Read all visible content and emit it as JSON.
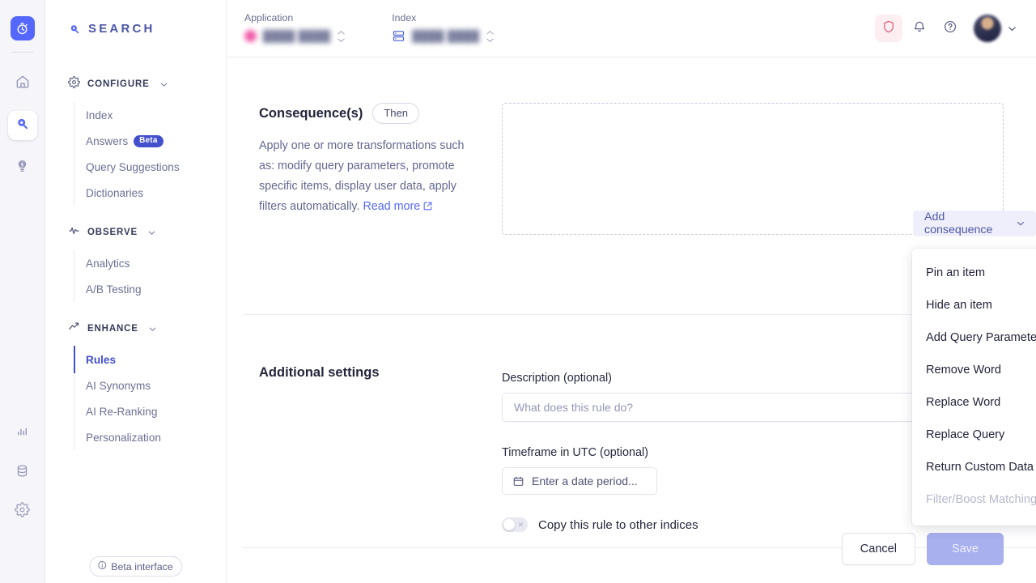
{
  "rail": {
    "logo": "algolia-logo",
    "items": [
      {
        "name": "home-icon"
      },
      {
        "name": "search-icon",
        "active": true
      },
      {
        "name": "recommend-bulb-icon"
      }
    ],
    "bottom_items": [
      {
        "name": "analytics-bars-icon"
      },
      {
        "name": "database-icon"
      },
      {
        "name": "gear-icon"
      }
    ]
  },
  "sidebar": {
    "brand": "SEARCH",
    "beta_chip": "Beta interface",
    "groups": [
      {
        "title": "CONFIGURE",
        "icon": "gear-icon",
        "items": [
          {
            "label": "Index"
          },
          {
            "label": "Answers",
            "badge": "Beta"
          },
          {
            "label": "Query Suggestions"
          },
          {
            "label": "Dictionaries"
          }
        ]
      },
      {
        "title": "OBSERVE",
        "icon": "pulse-icon",
        "items": [
          {
            "label": "Analytics"
          },
          {
            "label": "A/B Testing"
          }
        ]
      },
      {
        "title": "ENHANCE",
        "icon": "trend-up-icon",
        "items": [
          {
            "label": "Rules",
            "active": true
          },
          {
            "label": "AI Synonyms"
          },
          {
            "label": "AI Re-Ranking"
          },
          {
            "label": "Personalization"
          }
        ]
      }
    ]
  },
  "topbar": {
    "application_label": "Application",
    "application_value": "████ ████",
    "index_label": "Index",
    "index_value": "████ ████",
    "icons": [
      {
        "name": "shield-icon"
      },
      {
        "name": "bell-icon"
      },
      {
        "name": "help-circle-icon"
      }
    ],
    "avatar": "user-avatar",
    "avatar_chevron": "chevron-down-icon"
  },
  "consequences": {
    "title": "Consequence(s)",
    "chip": "Then",
    "description": "Apply one or more transformations such as: modify query parameters, promote specific items, display user data, apply filters automatically.",
    "link_text": "Read more",
    "add_button": "Add consequence",
    "menu_items": [
      {
        "label": "Pin an item",
        "disabled": false
      },
      {
        "label": "Hide an item",
        "disabled": false
      },
      {
        "label": "Add Query Parameter",
        "disabled": false
      },
      {
        "label": "Remove Word",
        "disabled": false
      },
      {
        "label": "Replace Word",
        "disabled": false
      },
      {
        "label": "Replace Query",
        "disabled": false
      },
      {
        "label": "Return Custom Data",
        "disabled": false
      },
      {
        "label": "Filter/Boost Matching Attributes",
        "disabled": true
      }
    ]
  },
  "additional_settings": {
    "title": "Additional settings",
    "description_label": "Description (optional)",
    "description_placeholder": "What does this rule do?",
    "description_value": "",
    "timeframe_label": "Timeframe in UTC (optional)",
    "timeframe_placeholder": "Enter a date period...",
    "copy_toggle_label": "Copy this rule to other indices",
    "copy_toggle_state": "off"
  },
  "footer": {
    "cancel_label": "Cancel",
    "save_label": "Save",
    "save_disabled": true
  },
  "colors": {
    "brand": "#5468ff",
    "accent_purple": "#4250cd",
    "menu_text": "#21243a",
    "disabled_text": "#b5b8cb",
    "shield_red": "#e4637c",
    "save_disabled_bg": "#a8b0ee"
  }
}
